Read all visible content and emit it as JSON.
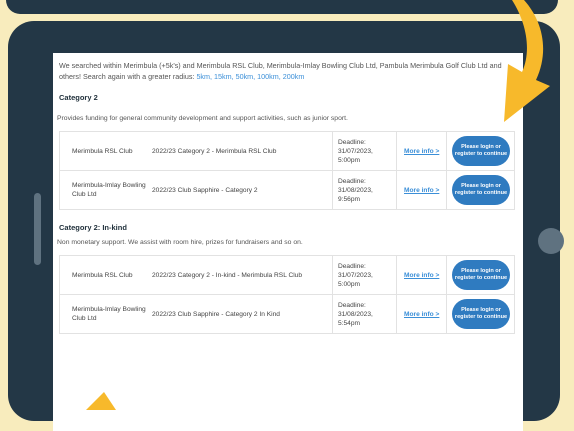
{
  "intro": {
    "text": "We searched within Merimbula (+5k's) and Merimbula RSL Club, Merimbula-Imlay Bowling Club Ltd, Pambula Merimbula Golf Club Ltd and others! Search again with a greater radius: ",
    "radius_links": [
      "5km,",
      "15km,",
      "50km,",
      "100km,",
      "200km"
    ]
  },
  "categories": [
    {
      "title": "Category 2",
      "description": "Provides funding for general community development and support activities, such as junior sport.",
      "rows": [
        {
          "club": "Merimbula RSL Club",
          "grant": "2022/23 Category 2 - Merimbula RSL Club",
          "deadline_label": "Deadline:",
          "deadline_date": "31/07/2023,",
          "deadline_time": "5:00pm",
          "more": "More info  >",
          "button": "Please login or register to continue"
        },
        {
          "club": "Merimbula-Imlay Bowling Club Ltd",
          "grant": "2022/23 Club Sapphire - Category 2",
          "deadline_label": "Deadline:",
          "deadline_date": "31/08/2023,",
          "deadline_time": "9:56pm",
          "more": "More info  >",
          "button": "Please login or register to continue"
        }
      ]
    },
    {
      "title": "Category 2: In-kind",
      "description": "Non monetary support. We assist with room hire, prizes for fundraisers and so on.",
      "rows": [
        {
          "club": "Merimbula RSL Club",
          "grant": "2022/23 Category 2 - In-kind - Merimbula RSL Club",
          "deadline_label": "Deadline:",
          "deadline_date": "31/07/2023,",
          "deadline_time": "5:00pm",
          "more": "More info  >",
          "button": "Please login or register to continue"
        },
        {
          "club": "Merimbula-Imlay Bowling Club Ltd",
          "grant": "2022/23 Club Sapphire - Category 2 In Kind",
          "deadline_label": "Deadline:",
          "deadline_date": "31/08/2023,",
          "deadline_time": "5:54pm",
          "more": "More info  >",
          "button": "Please login or register to continue"
        }
      ]
    }
  ],
  "colors": {
    "background": "#f8ecbd",
    "device": "#233746",
    "accent_arrow": "#f7b92b",
    "link": "#3b8fd8",
    "button": "#2f7bc0"
  }
}
